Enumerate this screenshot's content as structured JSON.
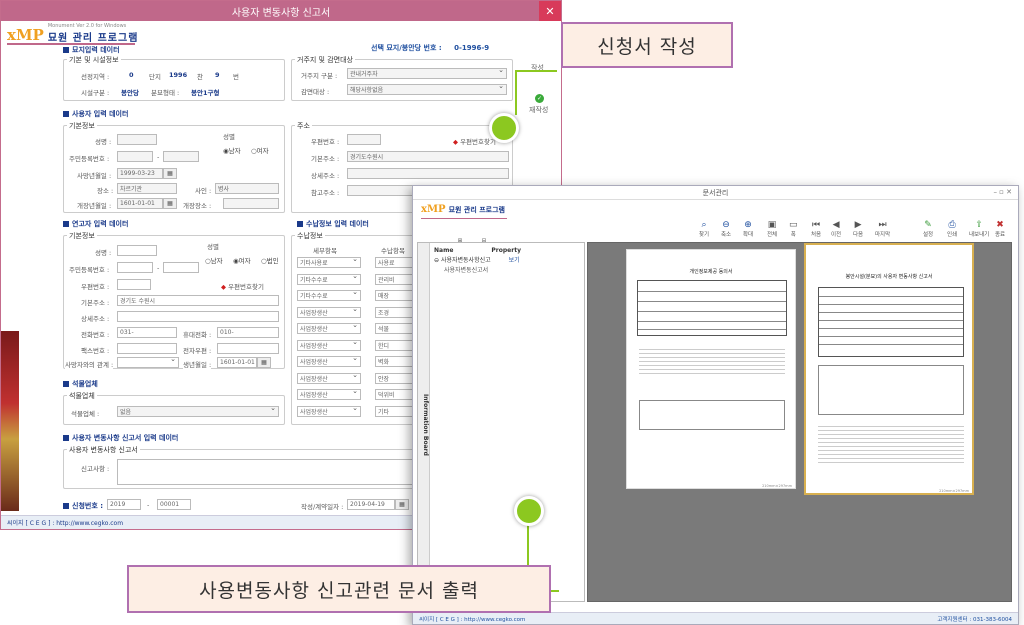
{
  "main_window": {
    "title": "사용자 변동사항 신고서",
    "logo": "xMP",
    "logo_sub": "Monument Ver 2.0 for Windows",
    "logo_name": "묘원 관리 프로그램",
    "selected_label": "선택 묘지/봉안당 번호 :",
    "selected_value": "0-1996-9",
    "status_label": "작성",
    "status_label2": "재작성",
    "sections": {
      "grave": "묘지입력 데이터",
      "user": "사용자 입력 데이터",
      "applicant": "연고자 입력 데이터",
      "payment": "수납정보 입력 데이터",
      "stone": "석물업체",
      "report": "사용자 변동사항 신고서 입력 데이터"
    },
    "groups": {
      "basic_facility": "기본 및 시설정보",
      "residence": "거주지 및 감면대상",
      "basic_info": "기본정보",
      "address": "주소",
      "basic_info2": "기본정보",
      "payment_info": "수납정보",
      "stone_company": "석물업체",
      "report_form": "사용자 변동사항 신고서"
    },
    "grave_fields": {
      "region_label": "선정지역 :",
      "region": "0",
      "block_label": "단지",
      "block": "1996",
      "row_label": "찬",
      "row": "9",
      "num_label": "번",
      "facility_label": "시설구분 :",
      "facility": "봉안당",
      "type_label": "분묘형태 :",
      "type": "봉안1구형",
      "residence_label": "거주지 구분 :",
      "residence": "관내거주자",
      "reduction_label": "감면대상 :",
      "reduction": "해당사항없음"
    },
    "user_fields": {
      "name_label": "성명 :",
      "name": "",
      "id_label": "주민등록번호 :",
      "sex_label": "성별",
      "male": "남자",
      "female": "여자",
      "death_label": "사망년월일 :",
      "death": "1999-03-23",
      "place_label": "장소 :",
      "place": "차르기관",
      "cause_label": "사인 :",
      "cause": "병사",
      "bury_label": "개장년월일 :",
      "bury": "1601-01-01",
      "bury2_label": "개장장소 :",
      "zip_label": "우편번호 :",
      "zip_btn": "우편번호찾기",
      "addr_label": "기본주소 :",
      "addr": "경기도수원시",
      "detail_label": "상세주소 :",
      "ref_label": "참고주소 :"
    },
    "applicant_fields": {
      "name_label": "성명 :",
      "id_label": "주민등록번호 :",
      "sex_label": "성별",
      "male": "남자",
      "female": "여자",
      "corp": "법인",
      "zip_label": "우편번호 :",
      "zip_btn": "우편번호찾기",
      "addr_label": "기본주소 :",
      "addr": "경기도 수원시",
      "detail_label": "상세주소 :",
      "phone_label": "전화번호 :",
      "phone": "031-",
      "mobile_label": "휴대전화 :",
      "mobile": "010-",
      "fax_label": "팩스번호 :",
      "email_label": "전자우편 :",
      "relation_label": "사망자와의 관계 :",
      "birth_label": "생년월일 :",
      "birth": "1601-01-01"
    },
    "payment": {
      "col1": "세부항목",
      "col2": "수납항목",
      "rows": [
        {
          "a": "기타사용료",
          "b": "사용료"
        },
        {
          "a": "기타수수료",
          "b": "관리비"
        },
        {
          "a": "기타수수료",
          "b": "매장"
        },
        {
          "a": "사업장생산",
          "b": "조경"
        },
        {
          "a": "사업장생산",
          "b": "석물"
        },
        {
          "a": "사업장생산",
          "b": "한디"
        },
        {
          "a": "사업장생산",
          "b": "벽화"
        },
        {
          "a": "사업장생산",
          "b": "안장"
        },
        {
          "a": "사업장생산",
          "b": "덕위비"
        },
        {
          "a": "사업장생산",
          "b": "기타"
        }
      ]
    },
    "stone_fields": {
      "label": "석물업체 :",
      "value": "없음"
    },
    "report_fields": {
      "reason_label": "신고사항 :"
    },
    "bottom": {
      "app_no_label": "신청번호 :",
      "year": "2019",
      "dash": "-",
      "seq": "00001",
      "date_label": "작성/계약일자 :",
      "date": "2019-04-19"
    },
    "statusbar": "씨이지 [ C E G ] : http://www.cegko.com"
  },
  "doc_window": {
    "title": "문서관리",
    "window_controls": "– ▫ ✕",
    "logo": "xMP",
    "logo_name": "묘원 관리 프로그램",
    "toolbar": [
      {
        "label": "찾기",
        "icon": "search-icon"
      },
      {
        "label": "축소",
        "icon": "zoom-out-icon"
      },
      {
        "label": "확대",
        "icon": "zoom-in-icon"
      },
      {
        "label": "전체",
        "icon": "fit-icon"
      },
      {
        "label": "폭",
        "icon": "width-icon"
      },
      {
        "label": "처음",
        "icon": "first-icon"
      },
      {
        "label": "이전",
        "icon": "prev-icon"
      },
      {
        "label": "다음",
        "icon": "next-icon"
      },
      {
        "label": "마지막",
        "icon": "last-icon"
      },
      {
        "label": "설정",
        "icon": "settings-icon"
      },
      {
        "label": "인쇄",
        "icon": "print-icon"
      },
      {
        "label": "내보내기",
        "icon": "export-icon"
      },
      {
        "label": "종료",
        "icon": "exit-icon"
      }
    ],
    "left_tools": [
      {
        "label": "확장",
        "icon": "expand-icon"
      },
      {
        "label": "축소",
        "icon": "collapse-icon"
      }
    ],
    "info_board": "Information Board",
    "tree_name_header": "Name",
    "tree_prop_header": "Property",
    "tree_item": "사용자변동사항신고",
    "tree_item_prop": "보기",
    "tree_subitem": "사용자변동신고서",
    "page1": {
      "title": "개인정보제공 동의서",
      "footer": "210mm×297mm"
    },
    "page2": {
      "title": "봉안시설(분묘)의 사용자 변동사항 신고서",
      "footer": "210mm×297mm"
    },
    "status_left": "씨이지 [ C E G ] : http://www.cegko.com",
    "status_right": "고객지원센터 : 031-383-6004"
  },
  "callouts": {
    "write": "신청서 작성",
    "print": "사용변동사항 신고관련 문서 출력"
  },
  "colors": {
    "title": "#c0688a",
    "accent": "#8cc820",
    "callout_border": "#b070b0",
    "callout_bg": "#fdeee4",
    "label_blue": "#1a3a8a"
  }
}
